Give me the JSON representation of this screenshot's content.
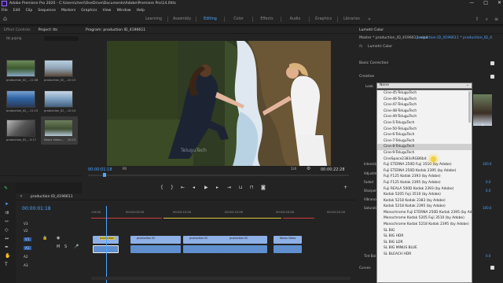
{
  "titlebar": {
    "title": "Adobe Premiere Pro 2020 - C:\\Users\\cheri\\OneDrive\\Documents\\Adobe\\Premiere Pro\\14.0\\ttc",
    "min": "—",
    "max": "□",
    "close": "✕"
  },
  "menu": [
    "File",
    "Edit",
    "Clip",
    "Sequence",
    "Markers",
    "Graphics",
    "View",
    "Window",
    "Help"
  ],
  "workspaces": [
    "Learning",
    "Assembly",
    "Editing",
    "Color",
    "Effects",
    "Audio",
    "Graphics",
    "Libraries"
  ],
  "workspace_active": "Editing",
  "project_panel": {
    "tabs": [
      "Effect Controls",
      "Project: ttc"
    ],
    "project_name": "ttc.prproj",
    "items": [
      {
        "name": "production_ID_...",
        "dur": "11:08"
      },
      {
        "name": "production_ID_...",
        "dur": "10:15"
      },
      {
        "name": "production_ID_...",
        "dur": "11:15"
      },
      {
        "name": "production_ID_...",
        "dur": "10:10"
      },
      {
        "name": "production_ID_...",
        "dur": "5:17"
      },
      {
        "name": "Nears Video...",
        "dur": "10:13"
      }
    ]
  },
  "program_monitor": {
    "title": "Program: production ID_4196611",
    "timecode_left": "00:00:01:18",
    "fit": "Fit",
    "quality": "1/4",
    "timecode_right": "00:00:22:28"
  },
  "timeline": {
    "tab": "production ID_4196611",
    "timecode": "00:00:01:18",
    "ruler": [
      ":00:00",
      "00:00:05:00",
      "00:00:10:00",
      "00:00:15:00",
      "00:00:20:00",
      "00:00:25:00"
    ],
    "tracks": [
      "V3",
      "V2",
      "V1",
      "A1",
      "A2",
      "A3"
    ],
    "clips_v1": [
      "production",
      "production ID",
      "production ID",
      "production ID",
      "Nears Video"
    ]
  },
  "lumetri": {
    "title": "Lumetri Color",
    "master": "Master * production_ID_4196611.mp4",
    "sequence": "production ID_4196611 * production_ID_4",
    "fx": "fx",
    "effect_name": "Lumetri Color",
    "basic_correction": "Basic Correction",
    "creative": "Creative",
    "look_label": "Look",
    "look_value": "None",
    "side_labels": [
      "Intensity",
      "Adjustments",
      "Faded",
      "Sharpen",
      "Vibrance",
      "Saturation",
      "Tint Bal",
      "Curves"
    ],
    "side_values": [
      "100.0",
      "0.0",
      "0.0",
      "100.0",
      "0.0"
    ]
  },
  "look_dropdown": {
    "items": [
      "Cine-45-TeluguTech",
      "Cine-46-TeluguTech",
      "Cine-47-TeluguTech",
      "Cine-48-TeluguTech",
      "Cine-49-TeluguTech",
      "Cine-5-TeluguTech",
      "Cine-50-TeluguTech",
      "Cine-6-TeluguTech",
      "Cine-7-TeluguTech",
      "Cine-8-TeluguTech",
      "Cine-9-TeluguTech",
      "CineSpace2383sRGB6bit",
      "Fuji ETERNA 250D Fuji 3510 (by Adobe)",
      "Fuji ETERNA 250D Kodak 2395 (by Adobe)",
      "Fuji F125 Kodak 2393 (by Adobe)",
      "Fuji F125 Kodak 2395 (by Adobe)",
      "Fuji REALA 500D Kodak 2393 (by Adobe)",
      "Kodak 5205 Fuji 3510 (by Adobe)",
      "Kodak 5218 Kodak 2383 (by Adobe)",
      "Kodak 5218 Kodak 2395 (by Adobe)",
      "Monochrome Fuji ETERNA 250D Kodak 2395 (by Adobe)",
      "Monochrome Kodak 5205 Fuji 3510 (by Adobe)",
      "Monochrome Kodak 5218 Kodak 2395 (by Adobe)",
      "SL BIG",
      "SL BIG HDR",
      "SL BIG LDR",
      "SL BIG MINUS BLUE",
      "SL BLEACH HDR"
    ],
    "highlighted_index": 9
  },
  "colors": {
    "accent": "#4ea6ff",
    "clip_v1": "#8fb0e6",
    "clip_v1_label": "#e7c53c",
    "clip_a1": "#5f8fcf",
    "dropdown_bg": "#f2f2f2"
  }
}
